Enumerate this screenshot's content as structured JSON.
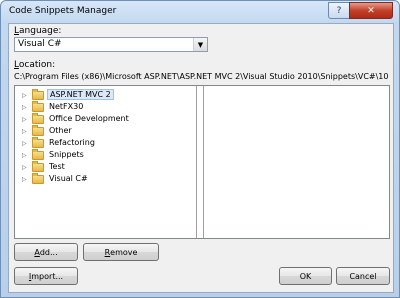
{
  "window": {
    "title": "Code Snippets Manager"
  },
  "titlebar": {
    "help_label": "?",
    "close_label": "✕"
  },
  "language": {
    "label": "Language:",
    "mnemonic": "L",
    "rest": "anguage:",
    "value": "Visual C#"
  },
  "location": {
    "label_mnemonic": "L",
    "label_rest": "ocation:",
    "path": "C:\\Program Files (x86)\\Microsoft ASP.NET\\ASP.NET MVC 2\\Visual Studio 2010\\Snippets\\VC#\\1033\\ASP.NET M"
  },
  "tree": {
    "items": [
      {
        "label": "ASP.NET MVC 2",
        "selected": true
      },
      {
        "label": "NetFX30",
        "selected": false
      },
      {
        "label": "Office Development",
        "selected": false
      },
      {
        "label": "Other",
        "selected": false
      },
      {
        "label": "Refactoring",
        "selected": false
      },
      {
        "label": "Snippets",
        "selected": false
      },
      {
        "label": "Test",
        "selected": false
      },
      {
        "label": "Visual C#",
        "selected": false
      }
    ]
  },
  "buttons": {
    "add": {
      "mnemonic": "A",
      "rest": "dd..."
    },
    "remove": {
      "mnemonic": "R",
      "rest": "emove"
    },
    "import": {
      "mnemonic": "I",
      "rest": "mport..."
    },
    "ok": "OK",
    "cancel": "Cancel"
  },
  "icons": {
    "expand": "triangle-right-icon",
    "folder": "folder-icon",
    "dropdown": "chevron-down-icon"
  }
}
